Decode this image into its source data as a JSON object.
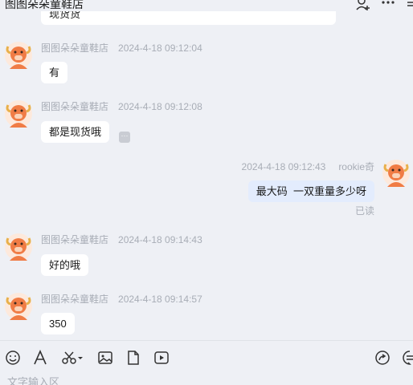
{
  "header": {
    "shop_name": "图图朵朵童鞋店"
  },
  "messages": [
    {
      "text": "现货货"
    },
    {
      "sender": "图图朵朵童鞋店",
      "time": "2024-4-18 09:12:04",
      "text": "有"
    },
    {
      "sender": "图图朵朵童鞋店",
      "time": "2024-4-18 09:12:08",
      "text": "都是现货哦"
    },
    {
      "sender": "rookie奇",
      "time": "2024-4-18 09:12:43",
      "text": "最大码  一双重量多少呀",
      "status": "已读"
    },
    {
      "sender": "图图朵朵童鞋店",
      "time": "2024-4-18 09:14:43",
      "text": "好的哦"
    },
    {
      "sender": "图图朵朵童鞋店",
      "time": "2024-4-18 09:14:57",
      "text": "350"
    }
  ],
  "input": {
    "placeholder": "文字输入区"
  },
  "icons": {
    "add_user": "add-user-icon",
    "more": "more-icon",
    "menu": "menu-icon",
    "emoji": "emoji-icon",
    "font": "font-icon",
    "scissors": "scissors-icon",
    "image": "image-icon",
    "file": "file-icon",
    "video": "video-icon",
    "share": "share-icon",
    "quick_reply": "quick-reply-icon"
  },
  "colors": {
    "background": "#eef0f5",
    "bubble_left": "#ffffff",
    "bubble_right": "#e3ecfd",
    "meta_text": "#a8adb6",
    "avatar_orange": "#f07c45"
  }
}
